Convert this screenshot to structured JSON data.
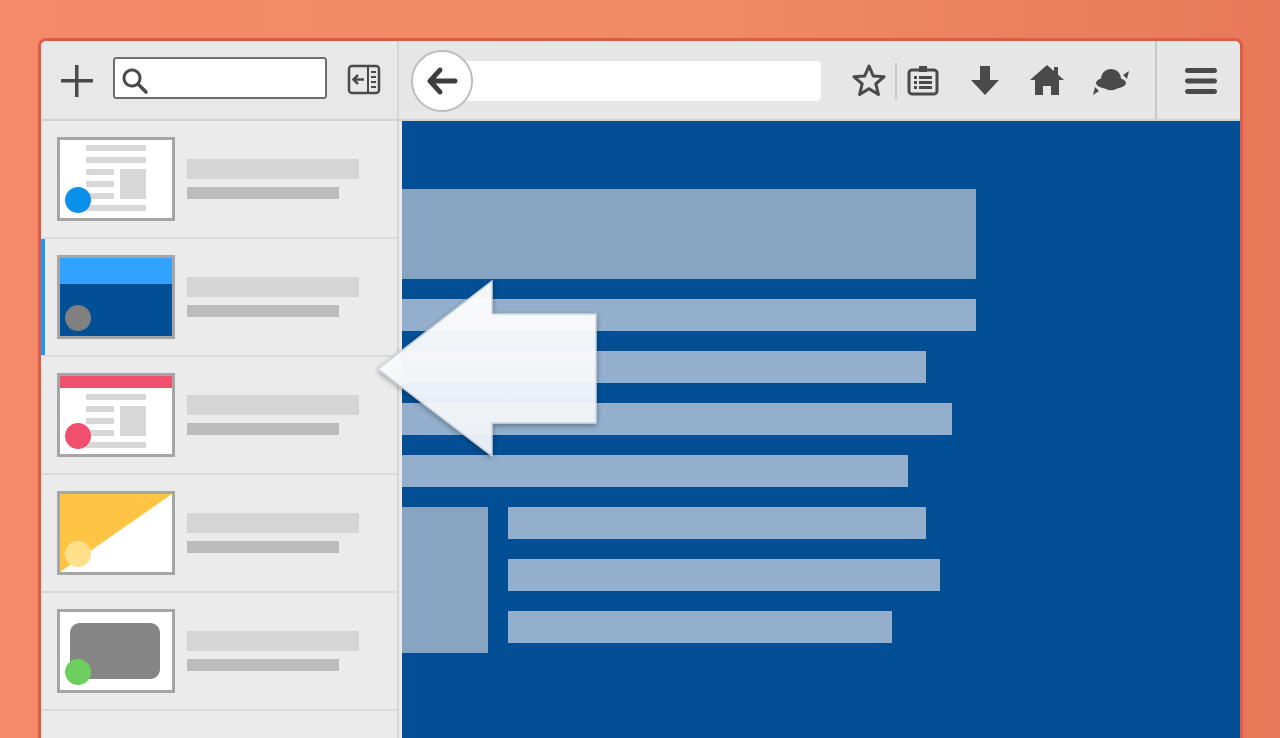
{
  "colors": {
    "background": "#f08a64",
    "window_border": "#de5b48",
    "selected_tab_accent": "#2196f3",
    "content_background": "#034f95",
    "content_blocks": "#9bb4cf"
  },
  "sidebar": {
    "search": {
      "value": "",
      "placeholder": ""
    },
    "icons": {
      "new_tab": "plus-icon",
      "search": "search-icon",
      "collapse": "collapse-sidebar-icon"
    },
    "tabs": [
      {
        "thumbnail": "document",
        "favicon_color": "#0a90ea",
        "selected": false
      },
      {
        "thumbnail": "blue-page",
        "favicon_color": "#808080",
        "selected": true
      },
      {
        "thumbnail": "red-header-document",
        "favicon_color": "#f0506e",
        "selected": false
      },
      {
        "thumbnail": "yellow-diagonal",
        "favicon_color": "#ffe08a",
        "selected": false
      },
      {
        "thumbnail": "gray-card",
        "favicon_color": "#6dcf5d",
        "selected": false
      }
    ]
  },
  "toolbar": {
    "url": {
      "value": "",
      "placeholder": ""
    },
    "icons": [
      "back-arrow-icon",
      "star-icon",
      "reading-list-icon",
      "download-icon",
      "home-icon",
      "sync-icon",
      "hamburger-menu-icon"
    ]
  },
  "overlay": {
    "icon": "large-left-arrow-icon"
  }
}
